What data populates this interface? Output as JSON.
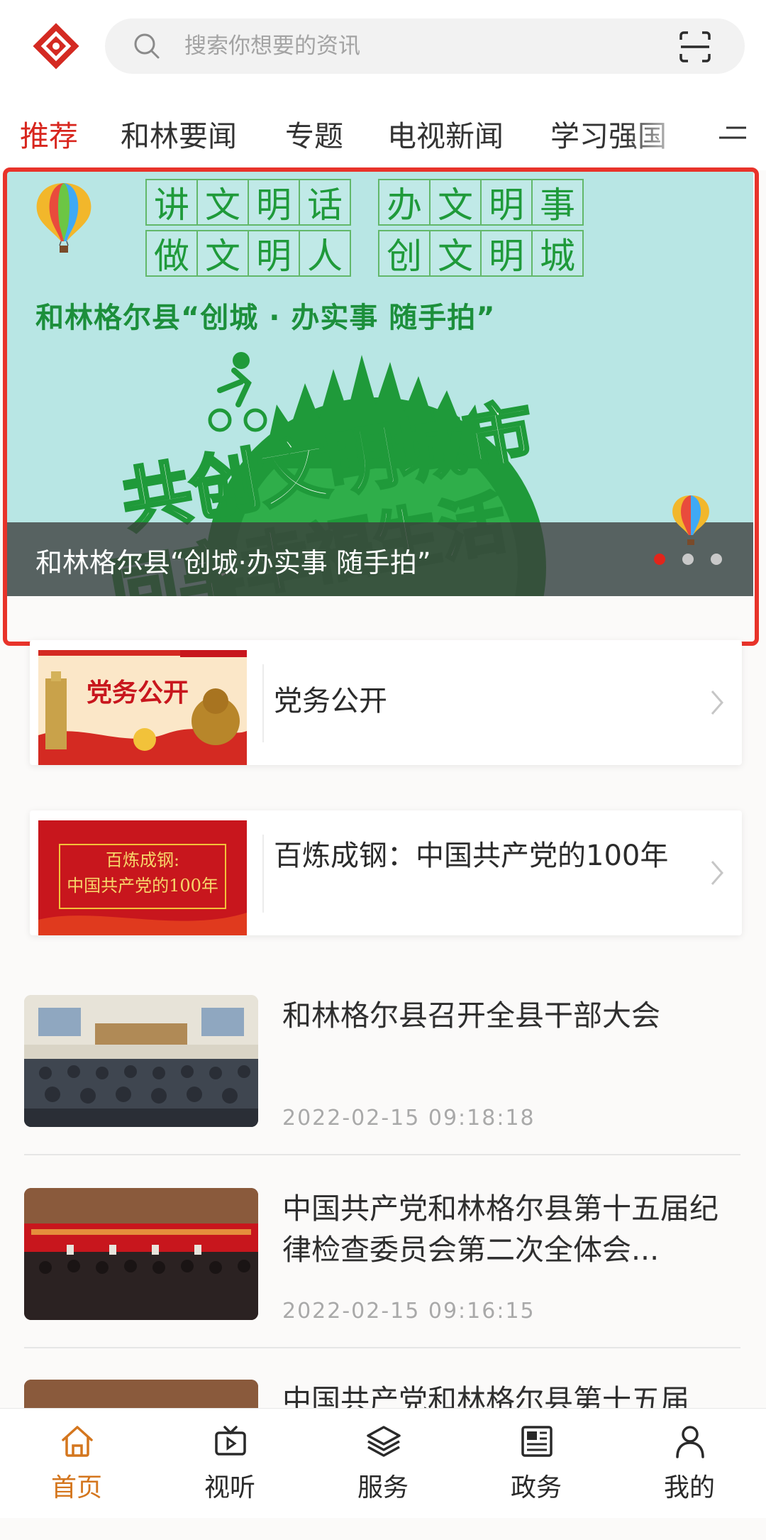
{
  "search": {
    "placeholder": "搜索你想要的资讯"
  },
  "tabs": [
    {
      "label": "推荐",
      "active": true
    },
    {
      "label": "和林要闻",
      "active": false
    },
    {
      "label": "专题",
      "active": false
    },
    {
      "label": "电视新闻",
      "active": false
    },
    {
      "label": "学习强国",
      "active": false
    }
  ],
  "banner": {
    "slogan_row1": [
      "讲",
      "文",
      "明",
      "话",
      "办",
      "文",
      "明",
      "事"
    ],
    "slogan_row2": [
      "做",
      "文",
      "明",
      "人",
      "创",
      "文",
      "明",
      "城"
    ],
    "subtitle": "和林格尔县“创城 · 办实事  随手拍”",
    "art_line1": "共创文明城市",
    "art_line2": "同享幸福生活",
    "caption": "和林格尔县“创城·办实事  随手拍”",
    "slide_count": 3,
    "active_slide": 1
  },
  "topics": [
    {
      "title": "党务公开",
      "thumb_text": "党务公开"
    },
    {
      "title": "百炼成钢：中国共产党的100年",
      "thumb_text_1": "百炼成钢:",
      "thumb_text_2": "中国共产党的100年"
    }
  ],
  "news": [
    {
      "title": "和林格尔县召开全县干部大会",
      "time": "2022-02-15  09:18:18"
    },
    {
      "title": "中国共产党和林格尔县第十五届纪律检查委员会第二次全体会...",
      "time": "2022-02-15  09:16:15"
    },
    {
      "title": "中国共产党和林格尔县第十五届",
      "time": ""
    }
  ],
  "bottom_nav": [
    {
      "label": "首页",
      "icon": "home-icon",
      "active": true
    },
    {
      "label": "视听",
      "icon": "tv-play-icon",
      "active": false
    },
    {
      "label": "服务",
      "icon": "layers-icon",
      "active": false
    },
    {
      "label": "政务",
      "icon": "newspaper-icon",
      "active": false
    },
    {
      "label": "我的",
      "icon": "user-icon",
      "active": false
    }
  ],
  "colors": {
    "accent_red": "#d8261e",
    "nav_active": "#d4761e",
    "banner_bg": "#b8e6e4",
    "banner_green": "#1f9a3a"
  }
}
